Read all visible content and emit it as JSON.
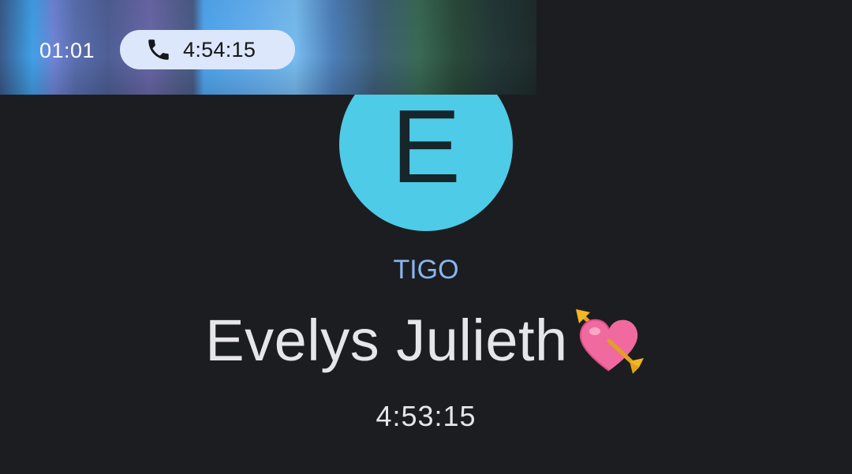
{
  "status_bar": {
    "time": "01:01"
  },
  "ongoing_call_chip": {
    "icon": "phone-icon",
    "duration": "4:54:15",
    "background": "#dce7fb"
  },
  "contact": {
    "avatar_letter": "E",
    "avatar_color": "#4ecbe6",
    "carrier": "TIGO",
    "name": "Evelys Julieth",
    "name_emoji": "heart-with-arrow-icon",
    "call_duration": "4:53:15"
  },
  "colors": {
    "background": "#1c1d20",
    "carrier_text": "#8ab4f0",
    "primary_text": "#e6e6ea"
  }
}
